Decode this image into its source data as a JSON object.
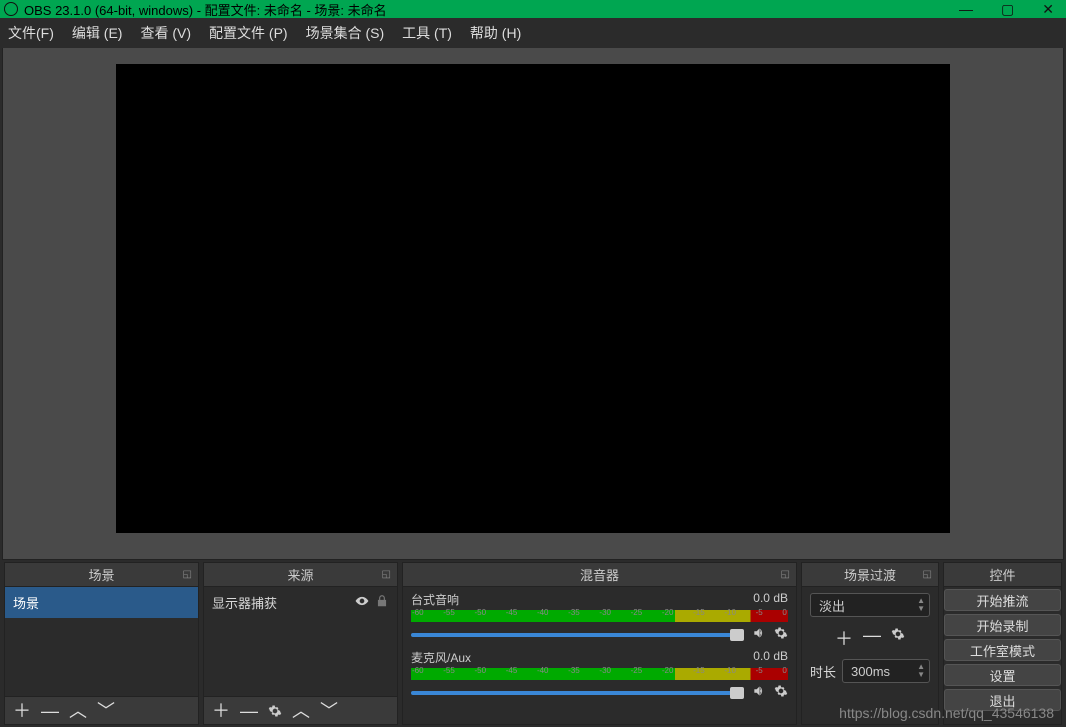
{
  "window": {
    "title": "OBS 23.1.0 (64-bit, windows) - 配置文件: 未命名 - 场景: 未命名"
  },
  "menu": {
    "file": "文件(F)",
    "edit": "编辑 (E)",
    "view": "查看 (V)",
    "profile": "配置文件 (P)",
    "scene_collection": "场景集合 (S)",
    "tools": "工具 (T)",
    "help": "帮助 (H)"
  },
  "panels": {
    "scenes": {
      "title": "场景",
      "items": [
        "场景"
      ]
    },
    "sources": {
      "title": "来源",
      "items": [
        {
          "label": "显示器捕获"
        }
      ]
    },
    "mixer": {
      "title": "混音器",
      "channels": [
        {
          "name": "台式音响",
          "level": "0.0 dB"
        },
        {
          "name": "麦克风/Aux",
          "level": "0.0 dB"
        }
      ],
      "scale_ticks": [
        "-60",
        "-55",
        "-50",
        "-45",
        "-40",
        "-35",
        "-30",
        "-25",
        "-20",
        "-15",
        "-10",
        "-5",
        "0"
      ]
    },
    "transitions": {
      "title": "场景过渡",
      "selected": "淡出",
      "duration_label": "时长",
      "duration_value": "300ms"
    },
    "controls": {
      "title": "控件",
      "buttons": {
        "start_stream": "开始推流",
        "start_record": "开始录制",
        "studio_mode": "工作室模式",
        "settings": "设置",
        "exit": "退出"
      }
    }
  },
  "watermark": "https://blog.csdn.net/qq_43546138"
}
